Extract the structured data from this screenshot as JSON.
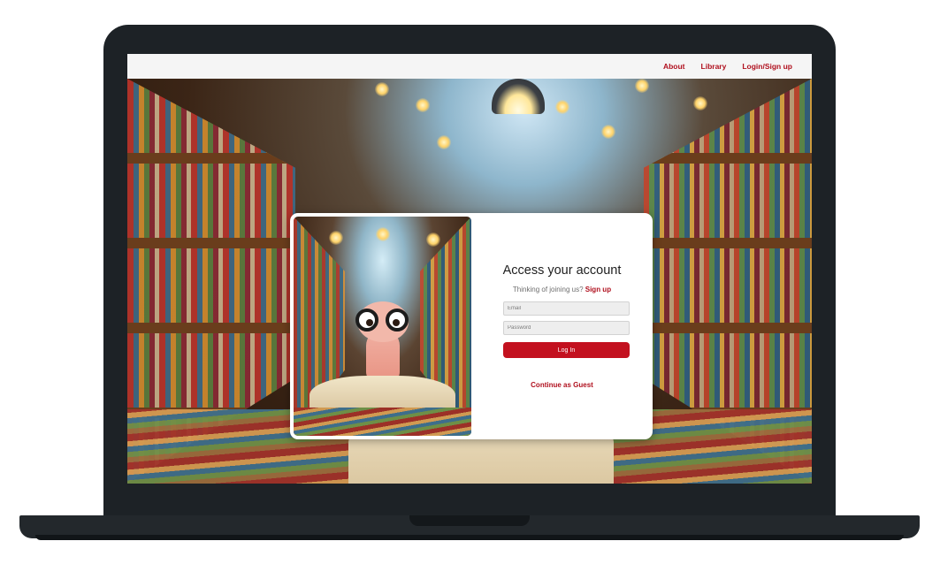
{
  "navbar": {
    "links": [
      "About",
      "Library",
      "Login/Sign up"
    ]
  },
  "login": {
    "title": "Access your account",
    "signup_prompt": "Thinking of joining us?",
    "signup_link": "Sign up",
    "email_placeholder": "Email",
    "password_placeholder": "Password",
    "login_button": "Log In",
    "guest_link": "Continue as Guest"
  },
  "colors": {
    "accent": "#c3111f",
    "link": "#b0101e",
    "bezel": "#1d2226"
  },
  "icons": {
    "illustration": "bookworm-library-illustration",
    "background": "library-background-image"
  }
}
